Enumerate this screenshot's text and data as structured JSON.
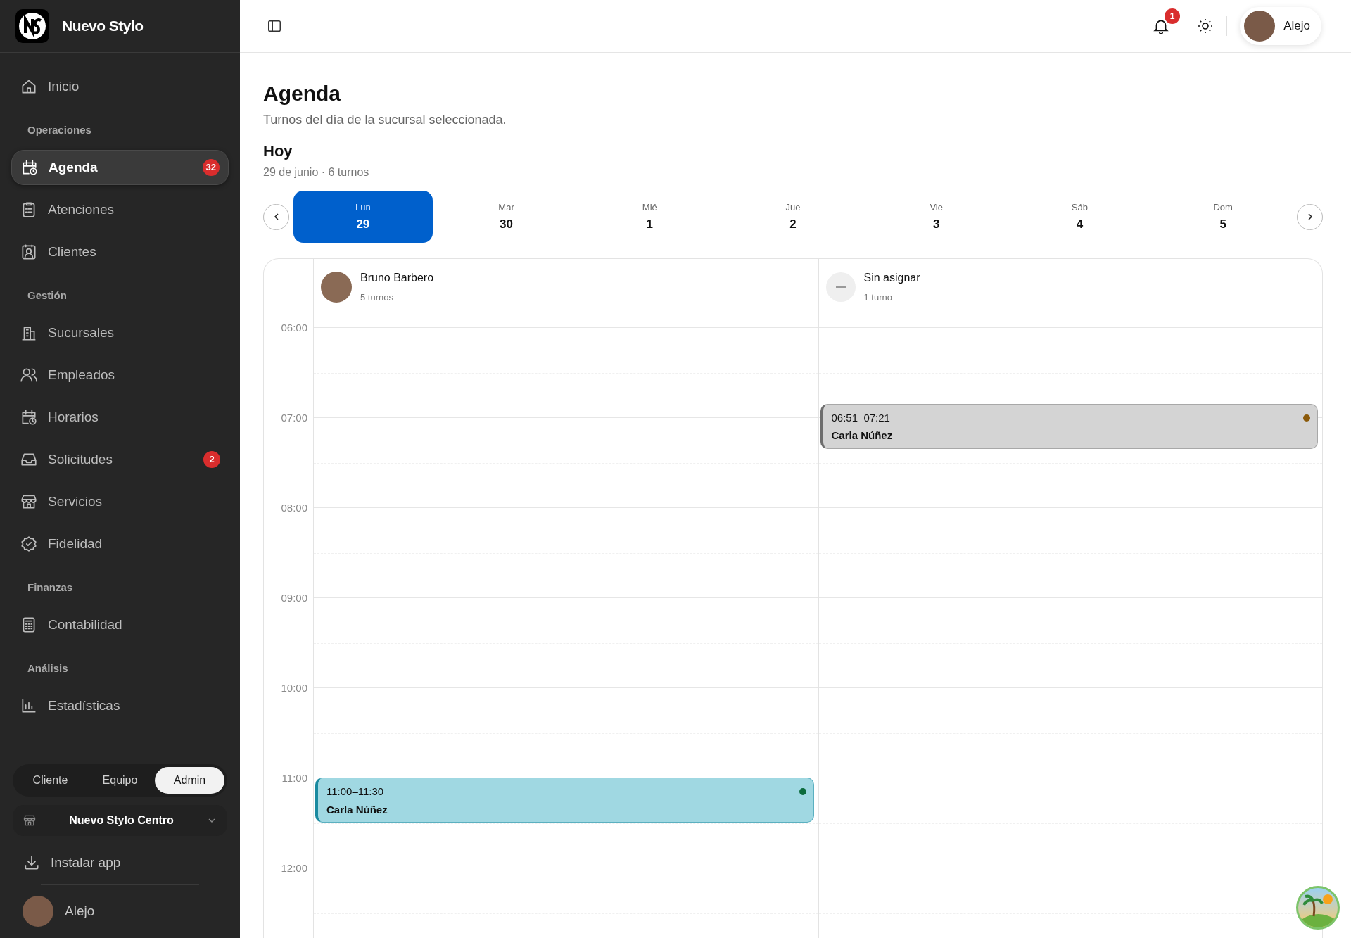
{
  "brand": {
    "name": "Nuevo Stylo"
  },
  "sidebar": {
    "groups": [
      {
        "items": [
          {
            "label": "Inicio",
            "selected": false
          }
        ]
      },
      {
        "heading": "Operaciones",
        "items": [
          {
            "label": "Agenda",
            "selected": true,
            "badge": "32"
          },
          {
            "label": "Atenciones",
            "selected": false
          },
          {
            "label": "Clientes",
            "selected": false
          }
        ]
      },
      {
        "heading": "Gestión",
        "items": [
          {
            "label": "Sucursales",
            "selected": false
          },
          {
            "label": "Empleados",
            "selected": false
          },
          {
            "label": "Horarios",
            "selected": false
          },
          {
            "label": "Solicitudes",
            "selected": false,
            "badge": "2"
          },
          {
            "label": "Servicios",
            "selected": false
          },
          {
            "label": "Fidelidad",
            "selected": false
          }
        ]
      },
      {
        "heading": "Finanzas",
        "items": [
          {
            "label": "Contabilidad",
            "selected": false
          }
        ]
      },
      {
        "heading": "Análisis",
        "items": [
          {
            "label": "Estadísticas",
            "selected": false
          }
        ]
      }
    ],
    "role_switch": [
      {
        "label": "Cliente",
        "selected": false
      },
      {
        "label": "Equipo",
        "selected": false
      },
      {
        "label": "Admin",
        "selected": true
      }
    ],
    "branch_select": {
      "value": "Nuevo Stylo Centro"
    },
    "install": "Instalar app",
    "user": "Alejo"
  },
  "topbar": {
    "notifications": "1",
    "user": "Alejo"
  },
  "page": {
    "title": "Agenda",
    "subtitle": "Turnos del día de la sucursal seleccionada.",
    "day_heading": "Hoy",
    "day_summary": "29 de junio · 6 turnos"
  },
  "week": [
    {
      "weekday": "Lun",
      "date": "29",
      "selected": true
    },
    {
      "weekday": "Mar",
      "date": "30",
      "selected": false
    },
    {
      "weekday": "Mié",
      "date": "1",
      "selected": false
    },
    {
      "weekday": "Jue",
      "date": "2",
      "selected": false
    },
    {
      "weekday": "Vie",
      "date": "3",
      "selected": false
    },
    {
      "weekday": "Sáb",
      "date": "4",
      "selected": false
    },
    {
      "weekday": "Dom",
      "date": "5",
      "selected": false
    }
  ],
  "calendar": {
    "hours": [
      "06:00",
      "07:00",
      "08:00",
      "09:00",
      "10:00",
      "11:00",
      "12:00"
    ],
    "columns": [
      {
        "name": "Bruno Barbero",
        "count": "5 turnos",
        "kind": "staff",
        "events": [
          {
            "time": "11:00–11:30",
            "client": "Carla Núñez",
            "kind": "confirmed",
            "color": "#0b6b3c"
          }
        ]
      },
      {
        "name": "Sin asignar",
        "count": "1 turno",
        "kind": "unassigned",
        "events": [
          {
            "time": "06:51–07:21",
            "client": "Carla Núñez",
            "kind": "pending",
            "color": "#8b5a0a"
          }
        ]
      }
    ]
  }
}
